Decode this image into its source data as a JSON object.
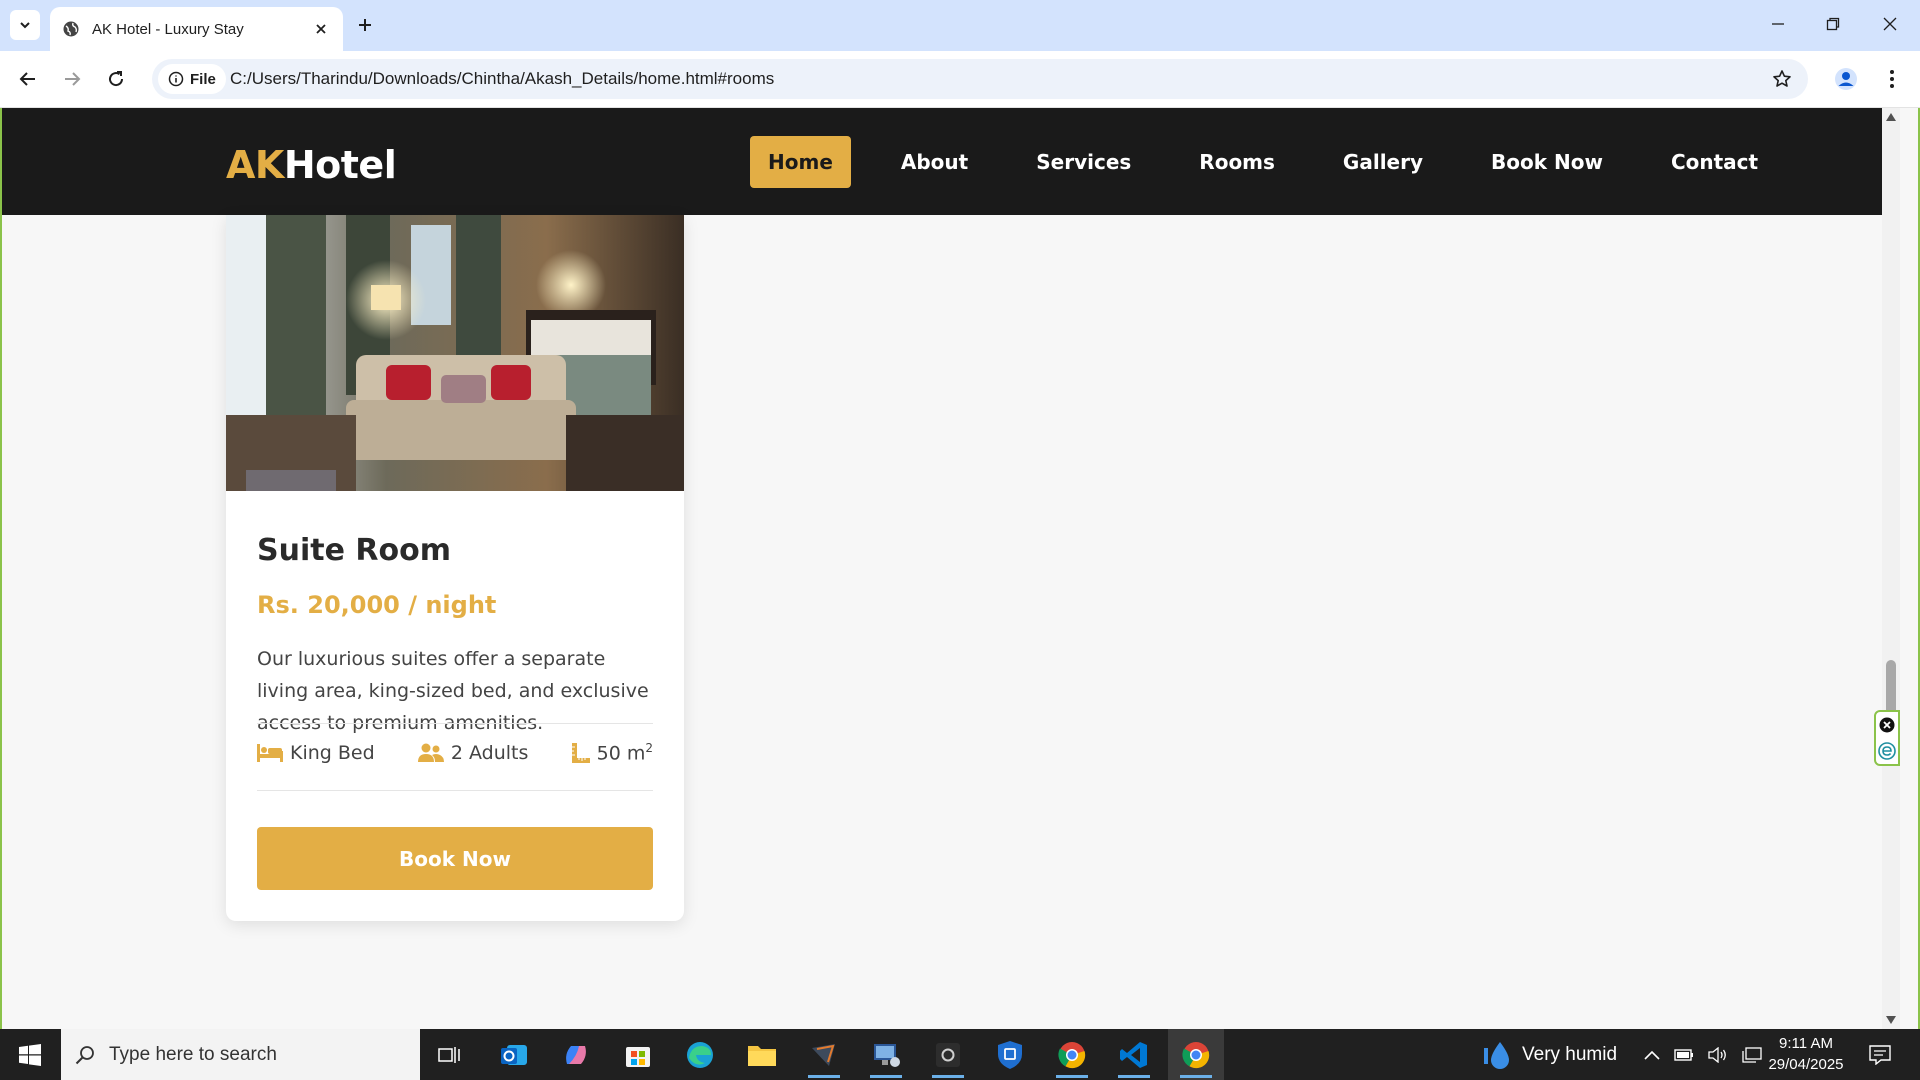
{
  "browser": {
    "tab_title": "AK Hotel - Luxury Stay",
    "url_chip": "File",
    "url": "C:/Users/Tharindu/Downloads/Chintha/Akash_Details/home.html#rooms"
  },
  "site": {
    "logo_accent": "AK",
    "logo_rest": "Hotel",
    "nav": [
      "Home",
      "About",
      "Services",
      "Rooms",
      "Gallery",
      "Book Now",
      "Contact"
    ],
    "active_nav": "Home",
    "accent_color": "#e3ae45",
    "header_color": "#1a1a1a"
  },
  "room": {
    "title": "Suite Room",
    "price": "Rs. 20,000 / night",
    "description": "Our luxurious suites offer a separate living area, king-sized bed, and exclusive access to premium amenities.",
    "features": {
      "bed": "King Bed",
      "guests": "2 Adults",
      "size": "50 m",
      "size_unit_sup": "2"
    },
    "button": "Book Now"
  },
  "taskbar": {
    "search_placeholder": "Type here to search",
    "weather": "Very humid",
    "time": "9:11 AM",
    "date": "29/04/2025"
  }
}
